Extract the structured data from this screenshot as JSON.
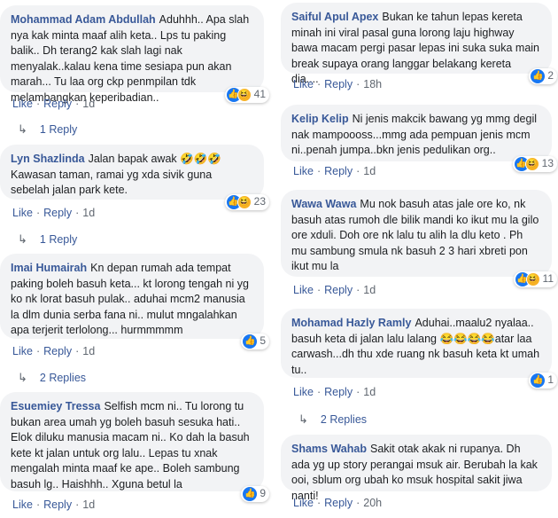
{
  "comments_left": [
    {
      "name": "Mohammad Adam Abdullah",
      "text": "Aduhhh.. Apa slah nya kak minta maaf alih keta.. Lps tu paking balik.. Dh terang2 kak slah lagi nak menyalak..kalau kena time sesiapa pun akan marah... Tu laa org ckp penmpilan tdk melambangkan keperibadian..",
      "reaction_count": "41",
      "time": "1d",
      "replies": "1 Reply"
    },
    {
      "name": "Lyn Shazlinda",
      "text": "Jalan bapak awak 🤣🤣🤣 Kawasan taman, ramai yg xda sivik guna sebelah jalan park kete.",
      "reaction_count": "23",
      "time": "1d",
      "replies": "1 Reply"
    },
    {
      "name": "Imai Humairah",
      "text": "Kn depan rumah ada tempat paking boleh basuh keta... kt lorong tengah ni yg ko nk lorat basuh pulak.. aduhai mcm2 manusia la dlm dunia serba fana ni.. mulut mngalahkan apa terjerit terlolong... hurmmmmm",
      "reaction_count": "5",
      "time": "1d",
      "replies": "2 Replies"
    },
    {
      "name": "Esuemiey Tressa",
      "text": "Selfish mcm ni.. Tu lorong tu bukan area umah yg boleh basuh sesuka hati.. Elok diluku manusia macam ni.. Ko dah la basuh kete kt jalan untuk org lalu.. Lepas tu xnak mengalah minta maaf ke ape.. Boleh sambung basuh lg.. Haishhh.. Xguna betul la",
      "reaction_count": "9",
      "time": "1d"
    }
  ],
  "comments_right": [
    {
      "name": "Saiful Apul Apex",
      "text": "Bukan ke tahun lepas kereta minah ini viral pasal guna lorong laju highway bawa macam pergi pasar lepas ini suka suka main break supaya orang langgar belakang kereta dia....",
      "reaction_count": "2",
      "time": "18h"
    },
    {
      "name": "Kelip Kelip",
      "text": "Ni jenis makcik bawang yg mmg degil nak mampoooss...mmg ada pempuan jenis mcm ni..penah jumpa..bkn jenis pedulikan org..",
      "reaction_count": "13",
      "time": "1d"
    },
    {
      "name": "Wawa Wawa",
      "text": "Mu nok basuh atas jale ore ko, nk basuh atas rumoh dle bilik mandi ko ikut mu la gilo ore xduli. Doh ore nk lalu tu alih la dlu keto . Ph mu sambung smula nk basuh 2 3 hari xbreti pon ikut mu la",
      "reaction_count": "11",
      "time": "1d"
    },
    {
      "name": "Mohamad Hazly Ramly",
      "text": "Aduhai..maalu2 nyalaa.. basuh keta di jalan lalu lalang 😂😂😂😂atar laa carwash...dh thu xde ruang nk basuh keta kt umah tu..",
      "reaction_count": "1",
      "time": "1d",
      "replies": "2 Replies"
    },
    {
      "name": "Shams Wahab",
      "text": "Sakit otak akak ni rupanya. Dh ada yg up story perangai msuk air. Berubah la kak ooi, sblum org ubah ko msuk hospital sakit jiwa nanti!",
      "time": "20h"
    }
  ],
  "labels": {
    "like": "Like",
    "reply": "Reply",
    "dot": "·"
  },
  "colors": {
    "bubble": "#f2f3f5",
    "name": "#385898",
    "link": "#385898",
    "meta": "#606770"
  },
  "icons": {
    "like": "like-icon",
    "haha": "haha-icon",
    "reply_arrow": "reply-arrow-icon"
  }
}
